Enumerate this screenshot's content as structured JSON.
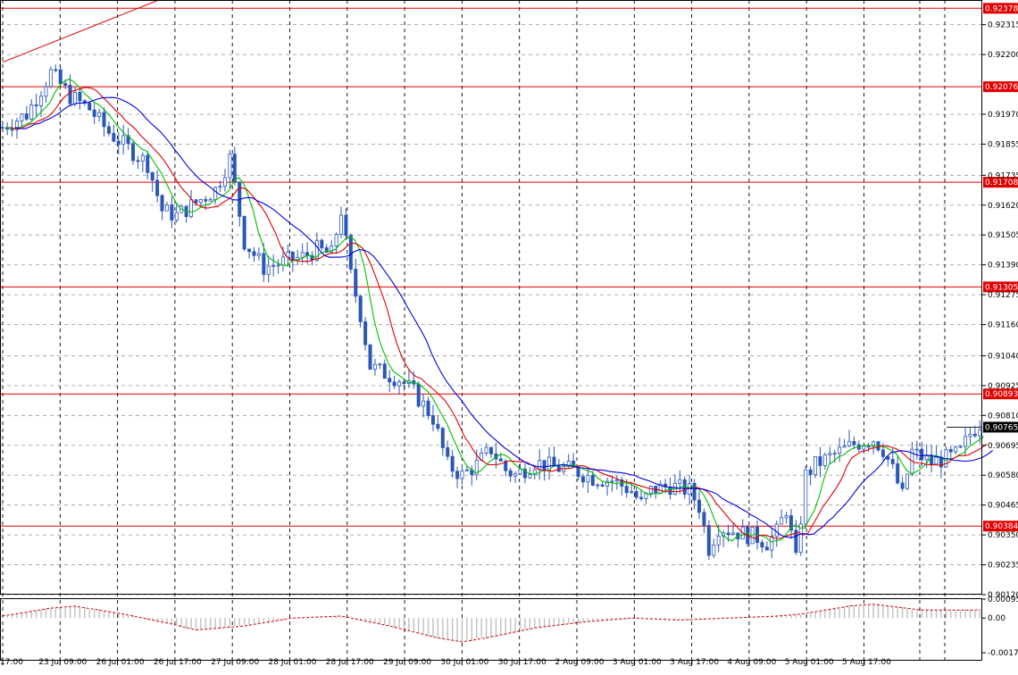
{
  "chart_data": [
    {
      "type": "candlestick",
      "symbol": "",
      "y_ticks": [
        "0.92315",
        "0.92200",
        "0.91970",
        "0.91855",
        "0.91735",
        "0.91620",
        "0.91505",
        "0.91390",
        "0.91275",
        "0.91160",
        "0.91040",
        "0.90925",
        "0.90810",
        "0.90695",
        "0.90580",
        "0.90465",
        "0.90350",
        "0.90235",
        "0.90120"
      ],
      "ylim": [
        0.9012,
        0.9241
      ],
      "x_ticks": [
        "17:00",
        "23 Jul 09:00",
        "26 Jul 01:00",
        "26 Jul 17:00",
        "27 Jul 09:00",
        "28 Jul 01:00",
        "28 Jul 17:00",
        "29 Jul 09:00",
        "30 Jul 01:00",
        "30 Jul 17:00",
        "2 Aug 09:00",
        "3 Aug 01:00",
        "3 Aug 17:00",
        "4 Aug 09:00",
        "5 Aug 01:00",
        "5 Aug 17:00"
      ],
      "horizontal_levels": [
        {
          "label": "0.92378",
          "value": 0.92378
        },
        {
          "label": "0.92076",
          "value": 0.92076
        },
        {
          "label": "0.91708",
          "value": 0.91708
        },
        {
          "label": "0.91305",
          "value": 0.91305
        },
        {
          "label": "0.90893",
          "value": 0.90893
        },
        {
          "label": "0.90384",
          "value": 0.90384
        }
      ],
      "current_price": {
        "label": "0.90765",
        "value": 0.90765
      },
      "trendline": {
        "from": [
          0,
          0.9217
        ],
        "to": [
          12,
          0.9241
        ]
      },
      "price_path": [
        [
          0,
          0.9192
        ],
        [
          5,
          0.9197
        ],
        [
          10,
          0.9213
        ],
        [
          14,
          0.9204
        ],
        [
          18,
          0.9199
        ],
        [
          22,
          0.919
        ],
        [
          26,
          0.9184
        ],
        [
          30,
          0.9178
        ],
        [
          33,
          0.916
        ],
        [
          36,
          0.9158
        ],
        [
          40,
          0.9163
        ],
        [
          44,
          0.9168
        ],
        [
          47,
          0.918
        ],
        [
          50,
          0.9148
        ],
        [
          54,
          0.9138
        ],
        [
          58,
          0.914
        ],
        [
          62,
          0.9142
        ],
        [
          65,
          0.9145
        ],
        [
          68,
          0.9143
        ],
        [
          70,
          0.916
        ],
        [
          72,
          0.9135
        ],
        [
          74,
          0.912
        ],
        [
          76,
          0.91
        ],
        [
          78,
          0.9098
        ],
        [
          82,
          0.9095
        ],
        [
          85,
          0.909
        ],
        [
          89,
          0.908
        ],
        [
          92,
          0.9062
        ],
        [
          95,
          0.9058
        ],
        [
          98,
          0.9062
        ],
        [
          101,
          0.9068
        ],
        [
          104,
          0.906
        ],
        [
          106,
          0.9058
        ],
        [
          110,
          0.9063
        ],
        [
          114,
          0.9061
        ],
        [
          118,
          0.906
        ],
        [
          122,
          0.9057
        ],
        [
          126,
          0.9056
        ],
        [
          130,
          0.9052
        ],
        [
          132,
          0.9047
        ],
        [
          134,
          0.9052
        ],
        [
          138,
          0.9054
        ],
        [
          142,
          0.9052
        ],
        [
          144,
          0.9046
        ],
        [
          146,
          0.903
        ],
        [
          148,
          0.9038
        ],
        [
          152,
          0.9036
        ],
        [
          156,
          0.9034
        ],
        [
          158,
          0.9032
        ],
        [
          160,
          0.9036
        ],
        [
          162,
          0.9045
        ],
        [
          164,
          0.9025
        ],
        [
          166,
          0.9058
        ],
        [
          168,
          0.9062
        ],
        [
          172,
          0.9066
        ],
        [
          176,
          0.907
        ],
        [
          180,
          0.9072
        ],
        [
          182,
          0.9068
        ],
        [
          184,
          0.906
        ],
        [
          186,
          0.905
        ],
        [
          188,
          0.9067
        ],
        [
          192,
          0.9063
        ],
        [
          196,
          0.9065
        ],
        [
          198,
          0.9067
        ],
        [
          200,
          0.9074
        ],
        [
          202,
          0.9078
        ]
      ],
      "ma_fast_color": "#00c000",
      "ma_mid_color": "#e00000",
      "ma_slow_color": "#0000e0",
      "candle_color": "#2a57b8",
      "level_color": "#e00000"
    },
    {
      "type": "oscillator",
      "y_ticks": [
        "0.000956",
        "0.00",
        "-0.00175"
      ],
      "ylim": [
        -0.00215,
        0.001
      ],
      "histogram_color": "#c0c0c0",
      "signal_color": "#d00000",
      "signal_path": [
        [
          0,
          0.0001
        ],
        [
          10,
          0.0005
        ],
        [
          15,
          0.0006
        ],
        [
          25,
          0.0002
        ],
        [
          35,
          -0.0003
        ],
        [
          40,
          -0.0006
        ],
        [
          50,
          -0.0004
        ],
        [
          60,
          0.0
        ],
        [
          70,
          0.0001
        ],
        [
          80,
          -0.0004
        ],
        [
          90,
          -0.001
        ],
        [
          95,
          -0.0012
        ],
        [
          100,
          -0.001
        ],
        [
          110,
          -0.0005
        ],
        [
          120,
          -0.0002
        ],
        [
          130,
          0.0
        ],
        [
          140,
          -0.0001
        ],
        [
          150,
          0.0
        ],
        [
          160,
          0.0001
        ],
        [
          165,
          0.0002
        ],
        [
          175,
          0.0006
        ],
        [
          180,
          0.0007
        ],
        [
          190,
          0.0004
        ],
        [
          202,
          0.0004
        ]
      ]
    }
  ]
}
